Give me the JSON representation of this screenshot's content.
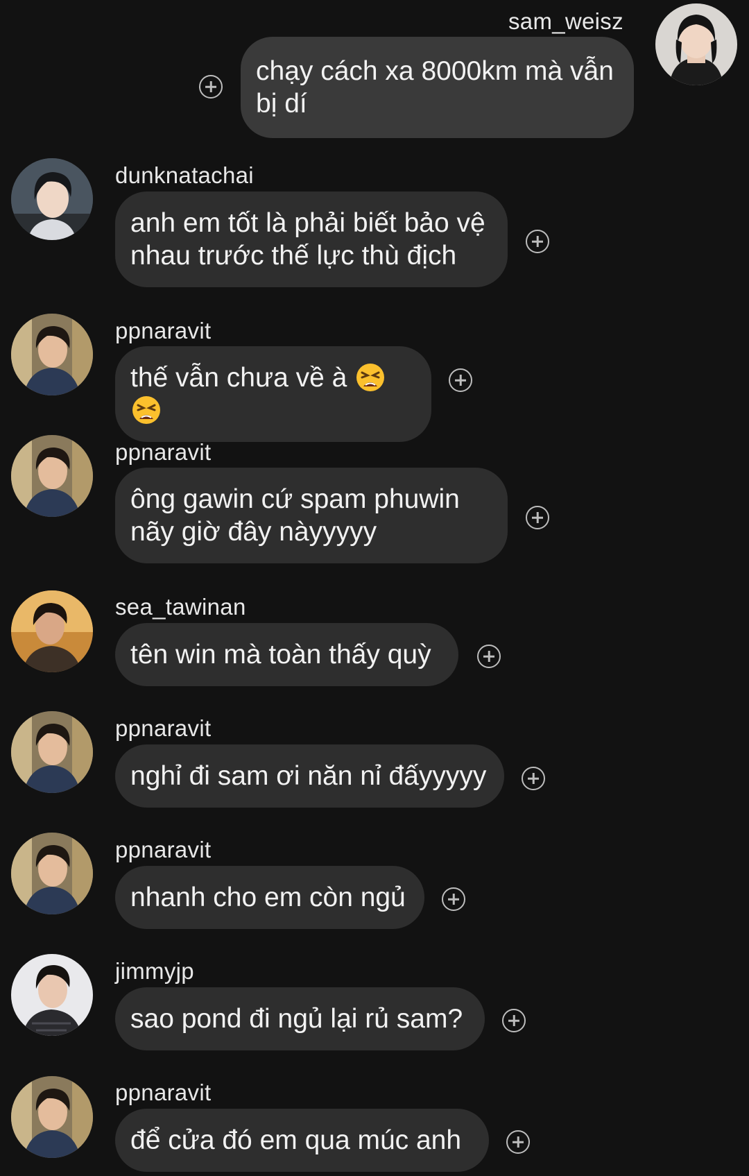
{
  "messages": [
    {
      "user": "sam_weisz",
      "text": "chạy cách xa 8000km mà vẫn bị dí",
      "self": true
    },
    {
      "user": "dunknatachai",
      "text": "anh em tốt là phải biết bảo vệ nhau trước thế lực thù địch"
    },
    {
      "user": "ppnaravit",
      "text": "thế vẫn chưa về à",
      "emoji": [
        "tired-face",
        "tired-face"
      ]
    },
    {
      "user": "ppnaravit",
      "text": "ông gawin cứ spam phuwin nãy giờ đây nàyyyyy"
    },
    {
      "user": "sea_tawinan",
      "text": "tên win mà toàn thấy quỳ"
    },
    {
      "user": "ppnaravit",
      "text": "nghỉ đi sam ơi năn nỉ đấyyyyy"
    },
    {
      "user": "ppnaravit",
      "text": "nhanh cho em còn ngủ"
    },
    {
      "user": "jimmyjp",
      "text": "sao pond đi ngủ lại rủ sam?"
    },
    {
      "user": "ppnaravit",
      "text": "để cửa đó em qua múc anh"
    }
  ],
  "colors": {
    "background": "#121212",
    "bubble": "#2e2e2e",
    "bubble_self": "#3a3a3a",
    "text": "#f2f2f2",
    "icon": "#bdbdbd"
  }
}
